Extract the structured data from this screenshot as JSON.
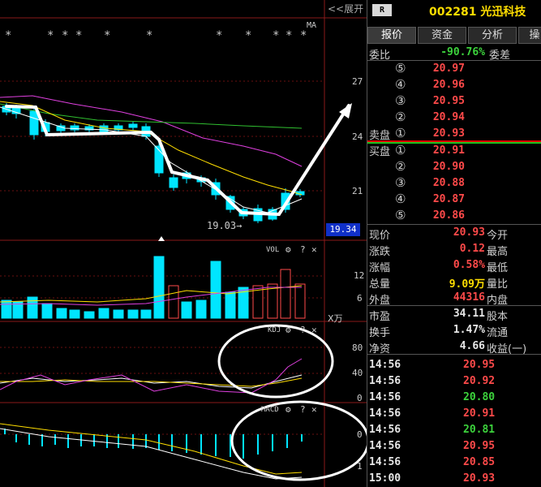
{
  "header": {
    "expand_label": "<<展开",
    "ma_label": "MA"
  },
  "price_chart": {
    "y_ticks": [
      "27",
      "24",
      "21"
    ],
    "low_label": "19.03→",
    "current_price_tag": "19.34",
    "stars_label": "*"
  },
  "vol_panel": {
    "title": "VOL",
    "y_ticks": [
      "12",
      "6"
    ],
    "unit": "X万"
  },
  "kdj_panel": {
    "title": "KDJ",
    "y_ticks": [
      "80",
      "40",
      "0"
    ]
  },
  "macd_panel": {
    "title": "MACD",
    "y_ticks": [
      "0",
      "1"
    ]
  },
  "panel_controls": {
    "help": "?",
    "close": "✕",
    "gear": "⚙"
  },
  "quote": {
    "badge": "R",
    "code_name": "002281 光迅科技",
    "tabs": [
      "报价",
      "资金",
      "分析",
      "操"
    ],
    "weibi_label": "委比",
    "weibi_value": "-90.76%",
    "weicha_label": "委差",
    "sell_label": "卖盘",
    "buy_label": "买盘",
    "sell_levels": [
      {
        "level": "⑤",
        "price": "20.97"
      },
      {
        "level": "④",
        "price": "20.96"
      },
      {
        "level": "③",
        "price": "20.95"
      },
      {
        "level": "②",
        "price": "20.94"
      },
      {
        "level": "①",
        "price": "20.93"
      }
    ],
    "buy_levels": [
      {
        "level": "①",
        "price": "20.91"
      },
      {
        "level": "②",
        "price": "20.90"
      },
      {
        "level": "③",
        "price": "20.88"
      },
      {
        "level": "④",
        "price": "20.87"
      },
      {
        "level": "⑤",
        "price": "20.86"
      }
    ],
    "stats": [
      {
        "l1": "现价",
        "v1": "20.93",
        "c1": "red",
        "l2": "今开"
      },
      {
        "l1": "涨跌",
        "v1": "0.12",
        "c1": "red",
        "l2": "最高"
      },
      {
        "l1": "涨幅",
        "v1": "0.58%",
        "c1": "red",
        "l2": "最低"
      },
      {
        "l1": "总量",
        "v1": "9.09万",
        "c1": "yellow",
        "l2": "量比"
      },
      {
        "l1": "外盘",
        "v1": "44316",
        "c1": "red",
        "l2": "内盘"
      }
    ],
    "fundamentals": [
      {
        "l1": "市盈",
        "v1": "34.11",
        "l2": "股本"
      },
      {
        "l1": "换手",
        "v1": "1.47%",
        "l2": "流通"
      },
      {
        "l1": "净资",
        "v1": "4.66",
        "l2": "收益(一)"
      }
    ],
    "ticks": [
      {
        "time": "14:56",
        "price": "20.95",
        "color": "red"
      },
      {
        "time": "14:56",
        "price": "20.92",
        "color": "red"
      },
      {
        "time": "14:56",
        "price": "20.80",
        "color": "green"
      },
      {
        "time": "14:56",
        "price": "20.91",
        "color": "red"
      },
      {
        "time": "14:56",
        "price": "20.81",
        "color": "green"
      },
      {
        "time": "14:56",
        "price": "20.95",
        "color": "red"
      },
      {
        "time": "14:56",
        "price": "20.85",
        "color": "red"
      },
      {
        "time": "15:00",
        "price": "20.93",
        "color": "red"
      }
    ]
  },
  "colors": {
    "up": "#ff4a4a",
    "down": "#00e5ff",
    "ma5": "#ffffff",
    "ma10": "#ffde00",
    "ma20": "#e040e0",
    "ma60": "#30c030",
    "grid": "#8a1a1a"
  }
}
